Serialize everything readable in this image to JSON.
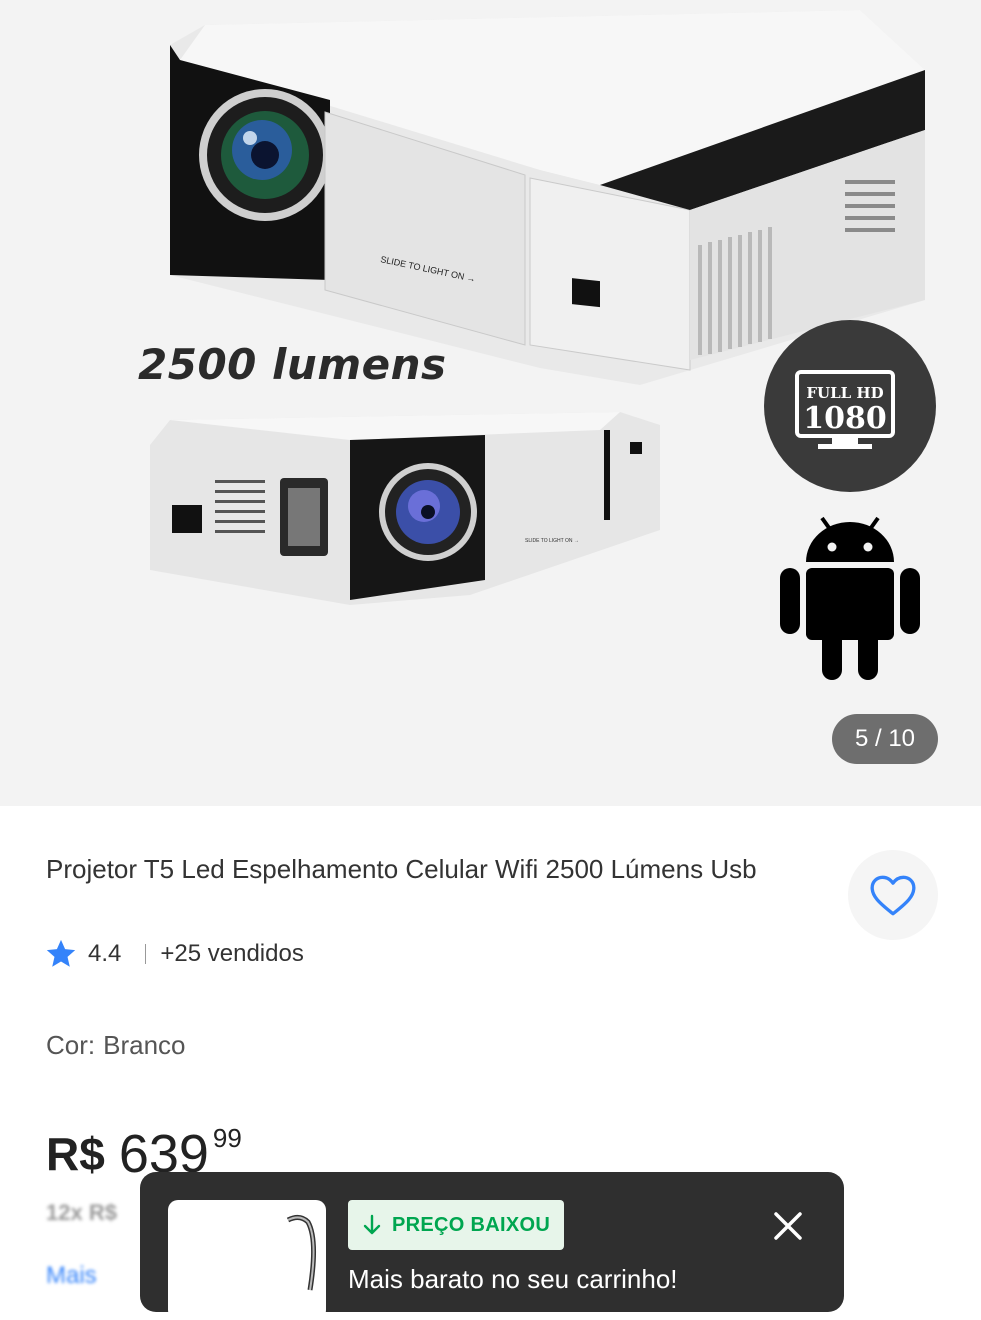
{
  "gallery": {
    "overlay_text": "2500 lumens",
    "slide_label": "SLIDE TO LIGHT ON",
    "badge_line1": "FULL HD",
    "badge_line2": "1080",
    "counter": "5 / 10"
  },
  "product": {
    "title": "Projetor T5 Led Espelhamento Celular Wifi 2500 Lúmens Usb",
    "rating": "4.4",
    "sold": "+25 vendidos",
    "color_label": "Cor:",
    "color_value": "Branco",
    "price_currency": "R$",
    "price_integer": "639",
    "price_cents": "99",
    "installments": "12x R$",
    "more_link": "Mais"
  },
  "toast": {
    "badge": "PREÇO BAIXOU",
    "message": "Mais barato no seu carrinho!"
  },
  "colors": {
    "accent_blue": "#3483fa",
    "green": "#00a650",
    "toast_bg": "#2f2f2f"
  },
  "icons": {
    "favorite": "heart-icon",
    "rating": "star-icon",
    "price_drop": "arrow-down-icon",
    "close": "close-icon"
  }
}
